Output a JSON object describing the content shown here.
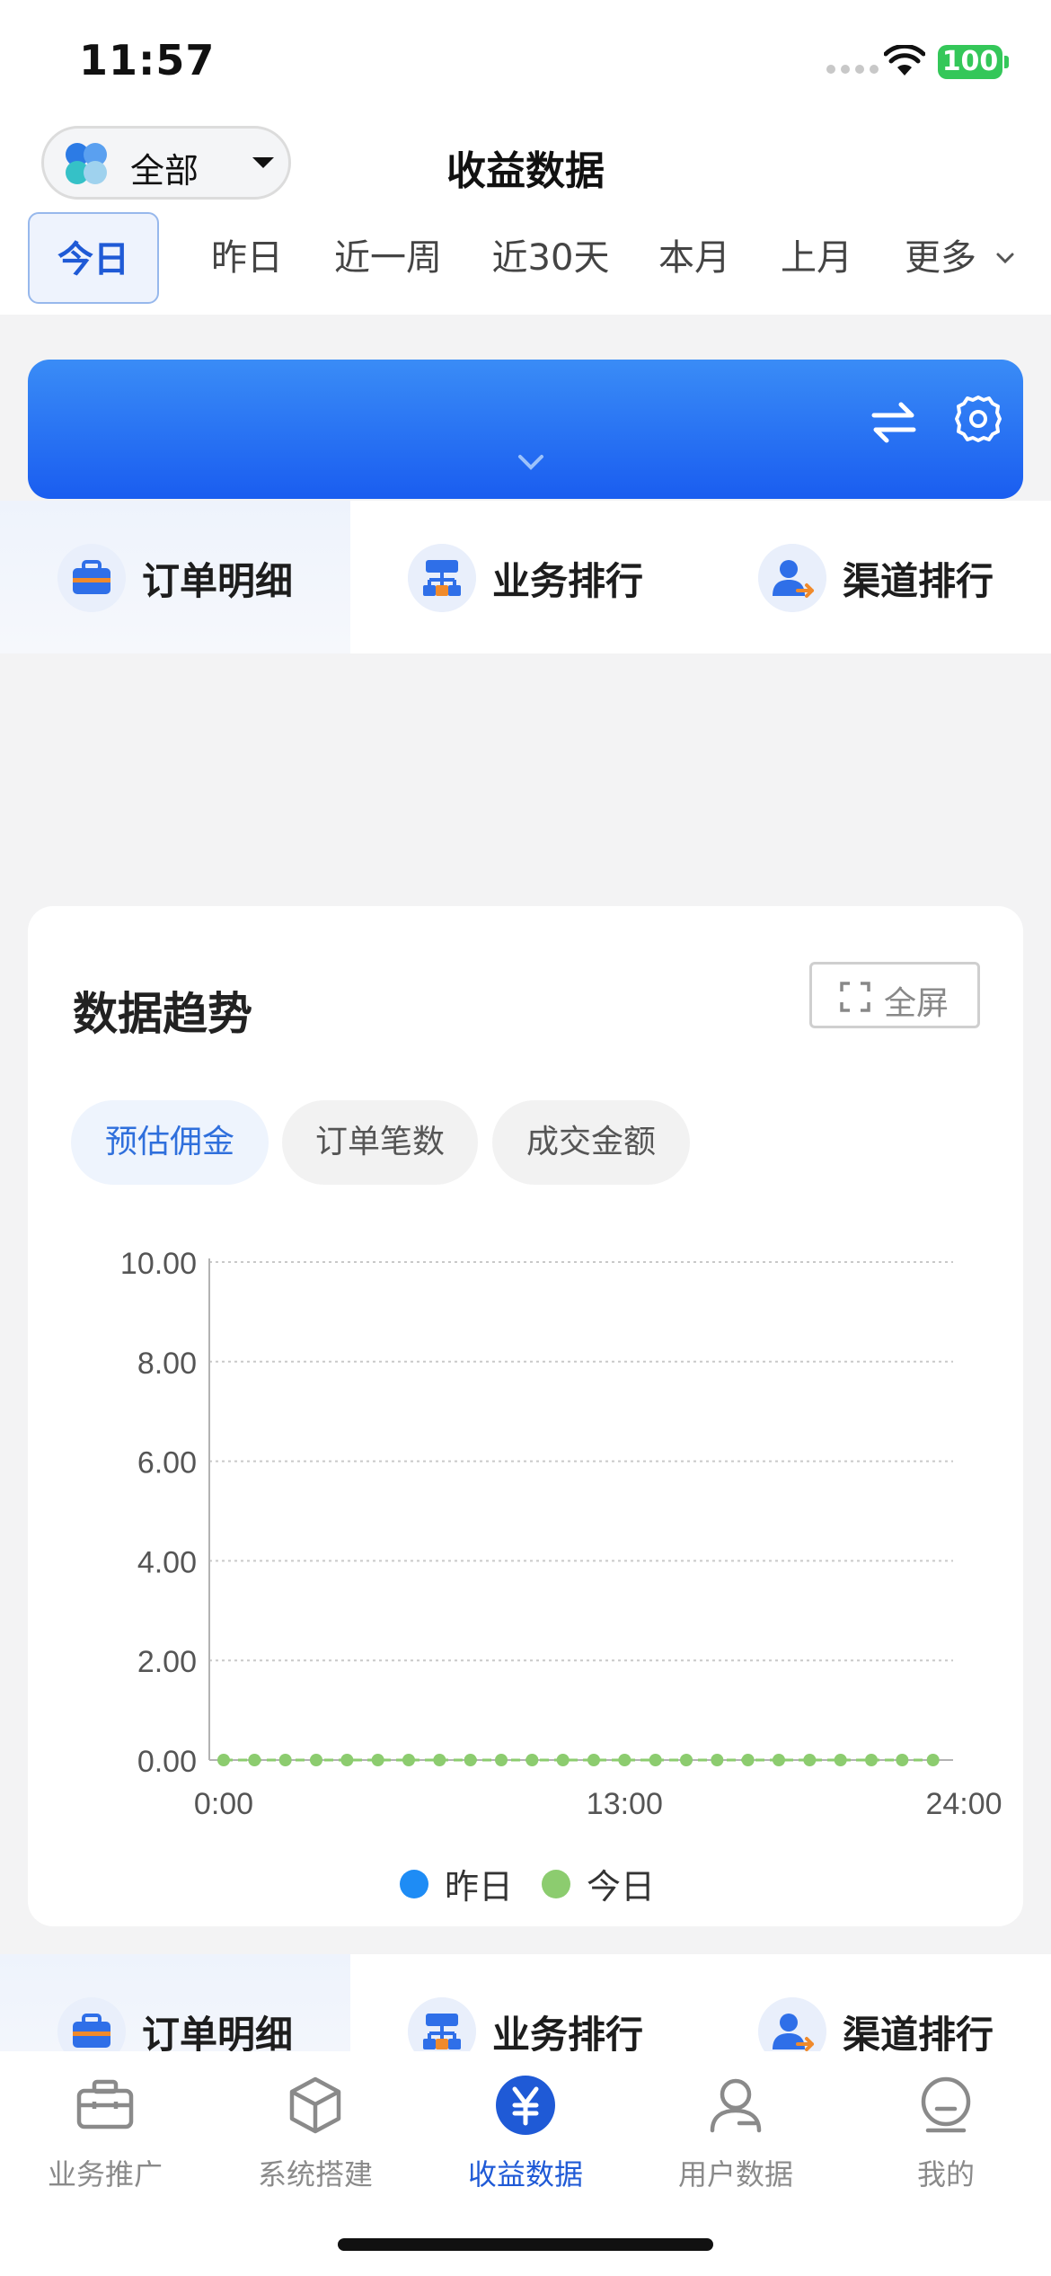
{
  "status": {
    "time": "11:57",
    "battery": "100"
  },
  "header": {
    "scope_label": "全部",
    "title": "收益数据",
    "periods": [
      "今日",
      "昨日",
      "近一周",
      "近30天",
      "本月",
      "上月",
      "更多"
    ],
    "active_period": "今日"
  },
  "quick_nav": [
    {
      "label": "订单明细",
      "icon": "briefcase-icon"
    },
    {
      "label": "业务排行",
      "icon": "org-chart-icon"
    },
    {
      "label": "渠道排行",
      "icon": "user-arrow-icon"
    }
  ],
  "trend": {
    "title": "数据趋势",
    "fullscreen_label": "全屏",
    "metrics": [
      "预估佣金",
      "订单笔数",
      "成交金额"
    ],
    "active_metric": "预估佣金"
  },
  "chart_data": {
    "type": "line",
    "x_tick_labels": [
      "0:00",
      "13:00",
      "24:00"
    ],
    "y_tick_labels": [
      "0.00",
      "2.00",
      "4.00",
      "6.00",
      "8.00",
      "10.00"
    ],
    "ylim": [
      0,
      10
    ],
    "x": [
      0,
      1,
      2,
      3,
      4,
      5,
      6,
      7,
      8,
      9,
      10,
      11,
      12,
      13,
      14,
      15,
      16,
      17,
      18,
      19,
      20,
      21,
      22,
      23
    ],
    "series": [
      {
        "name": "昨日",
        "color": "#1e8cf5",
        "values": []
      },
      {
        "name": "今日",
        "color": "#8ccc6f",
        "values": [
          0,
          0,
          0,
          0,
          0,
          0,
          0,
          0,
          0,
          0,
          0,
          0,
          0,
          0,
          0,
          0,
          0,
          0,
          0,
          0,
          0,
          0,
          0,
          0
        ]
      }
    ],
    "grid": true,
    "legend_position": "bottom"
  },
  "tab_bar": [
    {
      "label": "业务推广",
      "icon": "briefcase-icon"
    },
    {
      "label": "系统搭建",
      "icon": "cube-icon"
    },
    {
      "label": "收益数据",
      "icon": "yen-icon"
    },
    {
      "label": "用户数据",
      "icon": "user-icon"
    },
    {
      "label": "我的",
      "icon": "profile-icon"
    }
  ],
  "active_tab": "收益数据",
  "colors": {
    "brand_blue": "#1f5ad6",
    "today_green": "#8ccc6f",
    "yesterday_blue": "#1e8cf5"
  }
}
